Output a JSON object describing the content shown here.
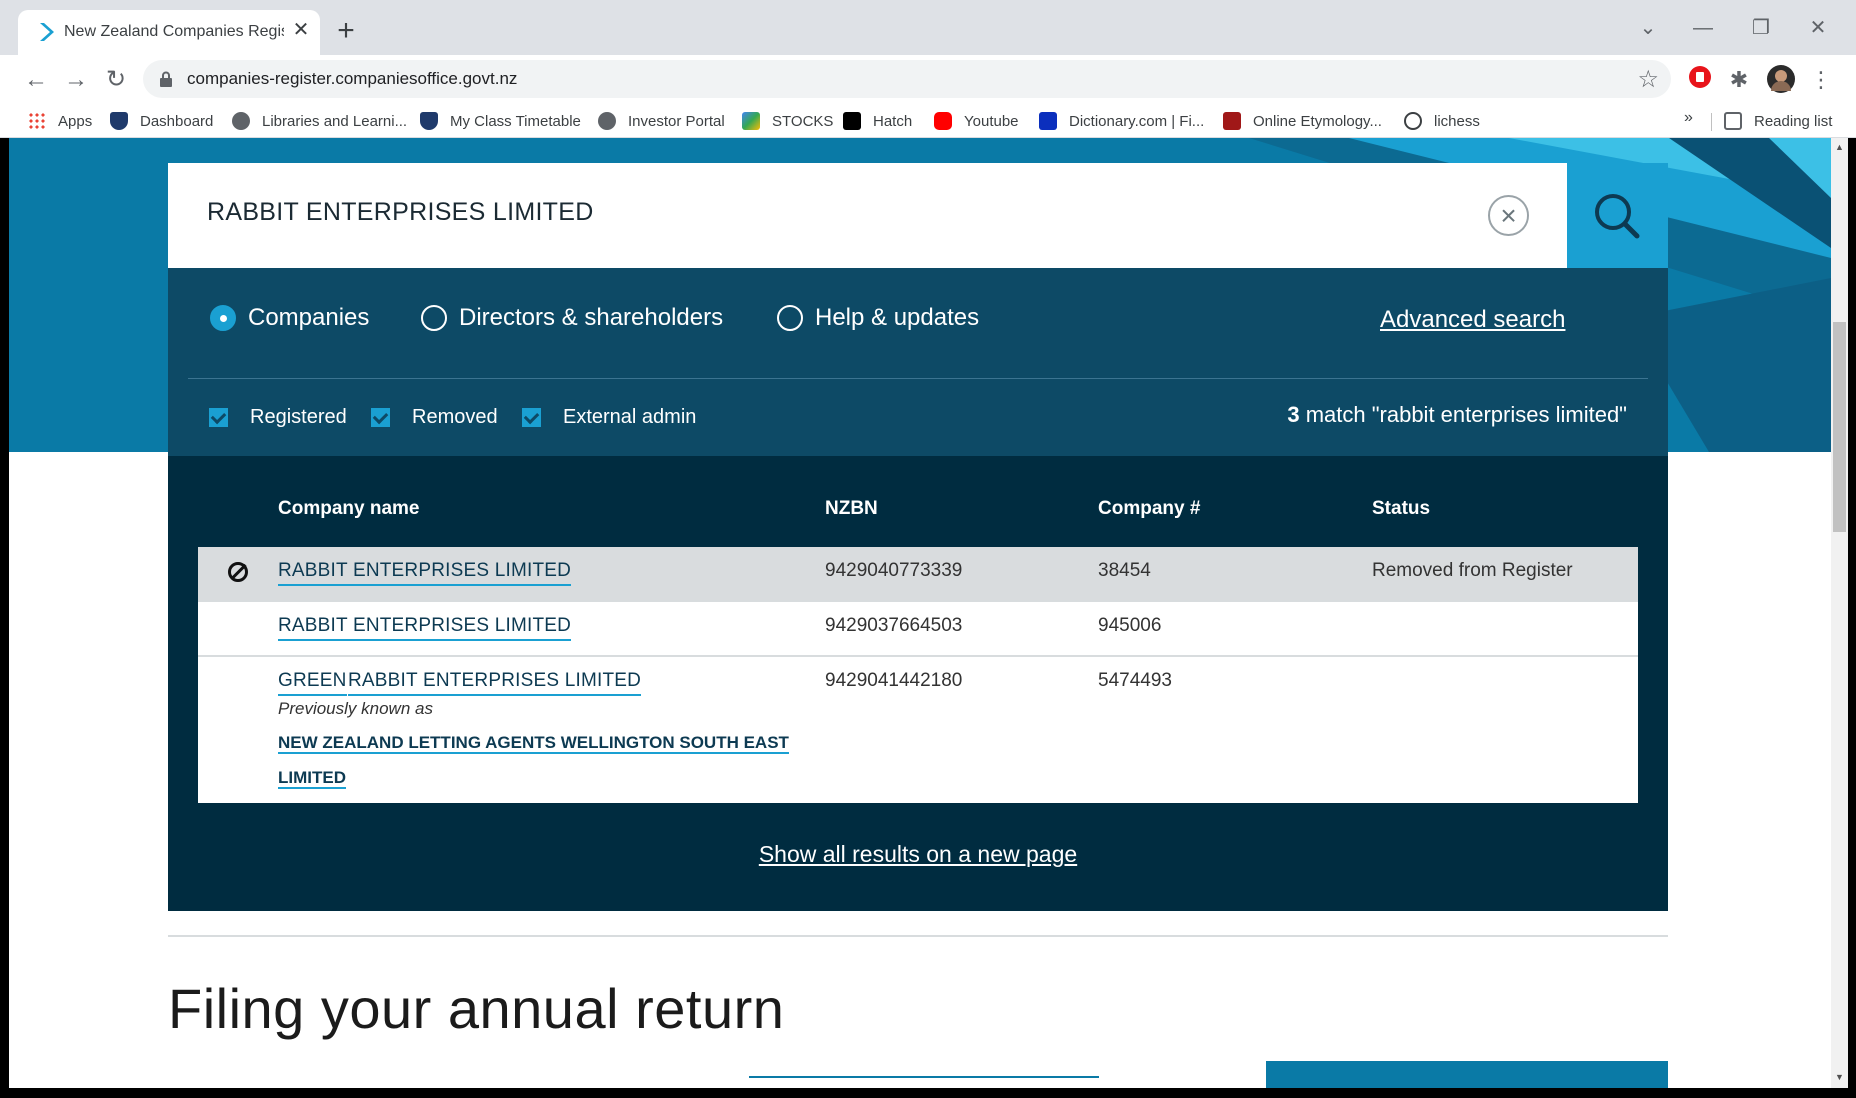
{
  "browser": {
    "tab_title": "New Zealand Companies Register",
    "tab_close": "✕",
    "new_tab": "+",
    "url": "companies-register.companiesoffice.govt.nz",
    "bookmarks": [
      {
        "label": "Apps",
        "icon": "apps-grid-icon",
        "color": "#ea4335"
      },
      {
        "label": "Dashboard",
        "icon": "shield-icon",
        "color": "#1f3a6b"
      },
      {
        "label": "Libraries and Learni...",
        "icon": "globe-icon",
        "color": "#5f6368"
      },
      {
        "label": "My Class Timetable",
        "icon": "shield-icon",
        "color": "#1f3a6b"
      },
      {
        "label": "Investor Portal",
        "icon": "globe-icon",
        "color": "#5f6368"
      },
      {
        "label": "STOCKS",
        "icon": "chart-icon",
        "color": "#34a853"
      },
      {
        "label": "Hatch",
        "icon": "hatch-icon",
        "color": "#000000"
      },
      {
        "label": "Youtube",
        "icon": "youtube-icon",
        "color": "#ff0000"
      },
      {
        "label": "Dictionary.com | Fi...",
        "icon": "dictionary-icon",
        "color": "#0b2fbd"
      },
      {
        "label": "Online Etymology...",
        "icon": "etymology-icon",
        "color": "#a01818"
      },
      {
        "label": "lichess",
        "icon": "lichess-icon",
        "color": "#3c4043"
      }
    ],
    "bookmarks_more": "»",
    "reading_list": "Reading list"
  },
  "search": {
    "query": "RABBIT ENTERPRISES LIMITED",
    "clear_label": "×",
    "types": [
      {
        "label": "Companies",
        "selected": true
      },
      {
        "label": "Directors & shareholders",
        "selected": false
      },
      {
        "label": "Help & updates",
        "selected": false
      }
    ],
    "advanced": "Advanced search",
    "filters": [
      "Registered",
      "Removed",
      "External admin"
    ],
    "match_count": "3",
    "match_text": " match \"rabbit enterprises limited\""
  },
  "results": {
    "headers": [
      "Company name",
      "NZBN",
      "Company #",
      "Status"
    ],
    "rows": [
      {
        "name": "RABBIT ENTERPRISES LIMITED",
        "nzbn": "9429040773339",
        "number": "38454",
        "status": "Removed from Register",
        "removed": true
      },
      {
        "name": "RABBIT ENTERPRISES LIMITED",
        "nzbn": "9429037664503",
        "number": "945006",
        "status": ""
      },
      {
        "name_prefix": "GREEN ",
        "name": "RABBIT ENTERPRISES LIMITED",
        "nzbn": "9429041442180",
        "number": "5474493",
        "status": "",
        "previously_known_label": "Previously known as",
        "previous_name_line1": "NEW ZEALAND LETTING AGENTS WELLINGTON SOUTH EAST",
        "previous_name_line2": "LIMITED"
      }
    ],
    "show_all": "Show all results on a new page"
  },
  "page": {
    "section_title": "Filing your annual return"
  },
  "colors": {
    "accent": "#1aa0d2",
    "panel": "#0d4a66",
    "results_bg": "#002c40",
    "hero": "#0a7aa6"
  }
}
